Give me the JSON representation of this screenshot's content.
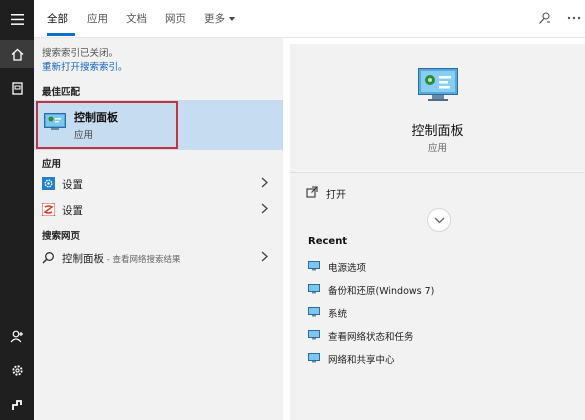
{
  "sidebar": {
    "icons": [
      "menu-icon",
      "home-icon",
      "documents-icon",
      "person-add-icon",
      "gear-icon",
      "user-icon"
    ]
  },
  "tabs": [
    {
      "label": "全部"
    },
    {
      "label": "应用"
    },
    {
      "label": "文档"
    },
    {
      "label": "网页"
    },
    {
      "label": "更多"
    }
  ],
  "results": {
    "info_line1": "搜索索引已关闭。",
    "info_line2": "重新打开搜索索引。",
    "best_match_header": "最佳匹配",
    "best_match": {
      "title": "控制面板",
      "subtitle": "应用"
    },
    "apps_header": "应用",
    "apps": [
      {
        "label": "设置",
        "icon": "settings-icon"
      },
      {
        "label": "设置",
        "icon": "settings-alt-icon"
      }
    ],
    "web_header": "搜索网页",
    "web": {
      "label": "控制面板",
      "hint": " - 查看网络搜索结果"
    }
  },
  "detail": {
    "title": "控制面板",
    "subtitle": "应用",
    "open_label": "打开",
    "recent_header": "Recent",
    "recent": [
      {
        "label": "电源选项"
      },
      {
        "label": "备份和还原(Windows 7)"
      },
      {
        "label": "系统"
      },
      {
        "label": "查看网络状态和任务"
      },
      {
        "label": "网络和共享中心"
      }
    ]
  },
  "colors": {
    "accent": "#0f6fce",
    "selection": "#c6dcf0",
    "highlight_border": "#c4323a",
    "rail": "#1f1f1f"
  }
}
